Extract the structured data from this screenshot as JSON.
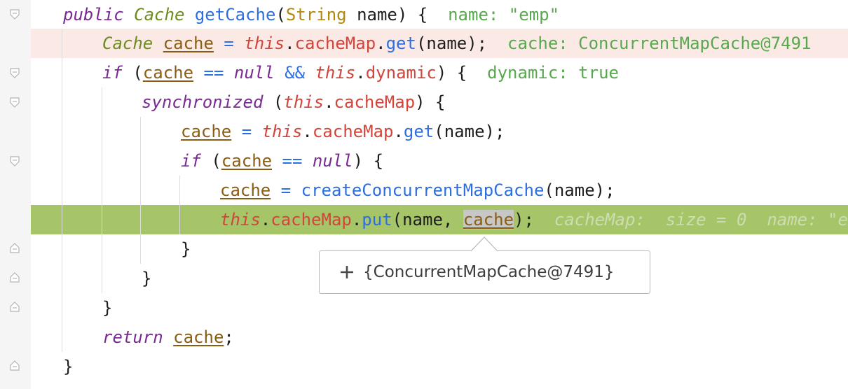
{
  "editor": {
    "lines": [
      {
        "line1_keyword": "public",
        "line1_type": "Cache",
        "line1_method": "getCache",
        "line1_param_type": "String",
        "line1_param_name": "name",
        "line1_hint": "name: \"emp\""
      },
      {
        "line2_type": "Cache",
        "line2_var": "cache",
        "line2_this": "this",
        "line2_field": "cacheMap",
        "line2_method": "get",
        "line2_arg": "name",
        "line2_hint": "cache: ConcurrentMapCache@7491"
      },
      {
        "line3_kw": "if",
        "line3_var": "cache",
        "line3_null": "null",
        "line3_this": "this",
        "line3_field": "dynamic",
        "line3_hint": "dynamic: true"
      },
      {
        "line4_kw": "synchronized",
        "line4_this": "this",
        "line4_field": "cacheMap"
      },
      {
        "line5_var": "cache",
        "line5_this": "this",
        "line5_field": "cacheMap",
        "line5_method": "get",
        "line5_arg": "name"
      },
      {
        "line6_kw": "if",
        "line6_var": "cache",
        "line6_null": "null"
      },
      {
        "line7_var": "cache",
        "line7_method": "createConcurrentMapCache",
        "line7_arg": "name"
      },
      {
        "line8_this": "this",
        "line8_field": "cacheMap",
        "line8_method": "put",
        "line8_arg1": "name",
        "line8_arg2": "cache",
        "line8_hint_map": "cacheMap:  size = 0",
        "line8_hint_name": "name: \"emp"
      },
      {
        "brace": "}"
      },
      {
        "brace": "}"
      },
      {
        "brace": "}"
      },
      {
        "line12_kw": "return",
        "line12_var": "cache"
      },
      {
        "brace": "}"
      }
    ]
  },
  "tooltip": {
    "expand_symbol": "+",
    "value": "{ConcurrentMapCache@7491}"
  },
  "colors": {
    "keyword": "#7a2b93",
    "type": "#6f8c21",
    "method": "#2d6ee0",
    "field": "#d2453b",
    "variable": "#8a5d14",
    "hint": "#58a84d",
    "execution_line": "#a6c569",
    "error_line": "#fbe9e6"
  }
}
